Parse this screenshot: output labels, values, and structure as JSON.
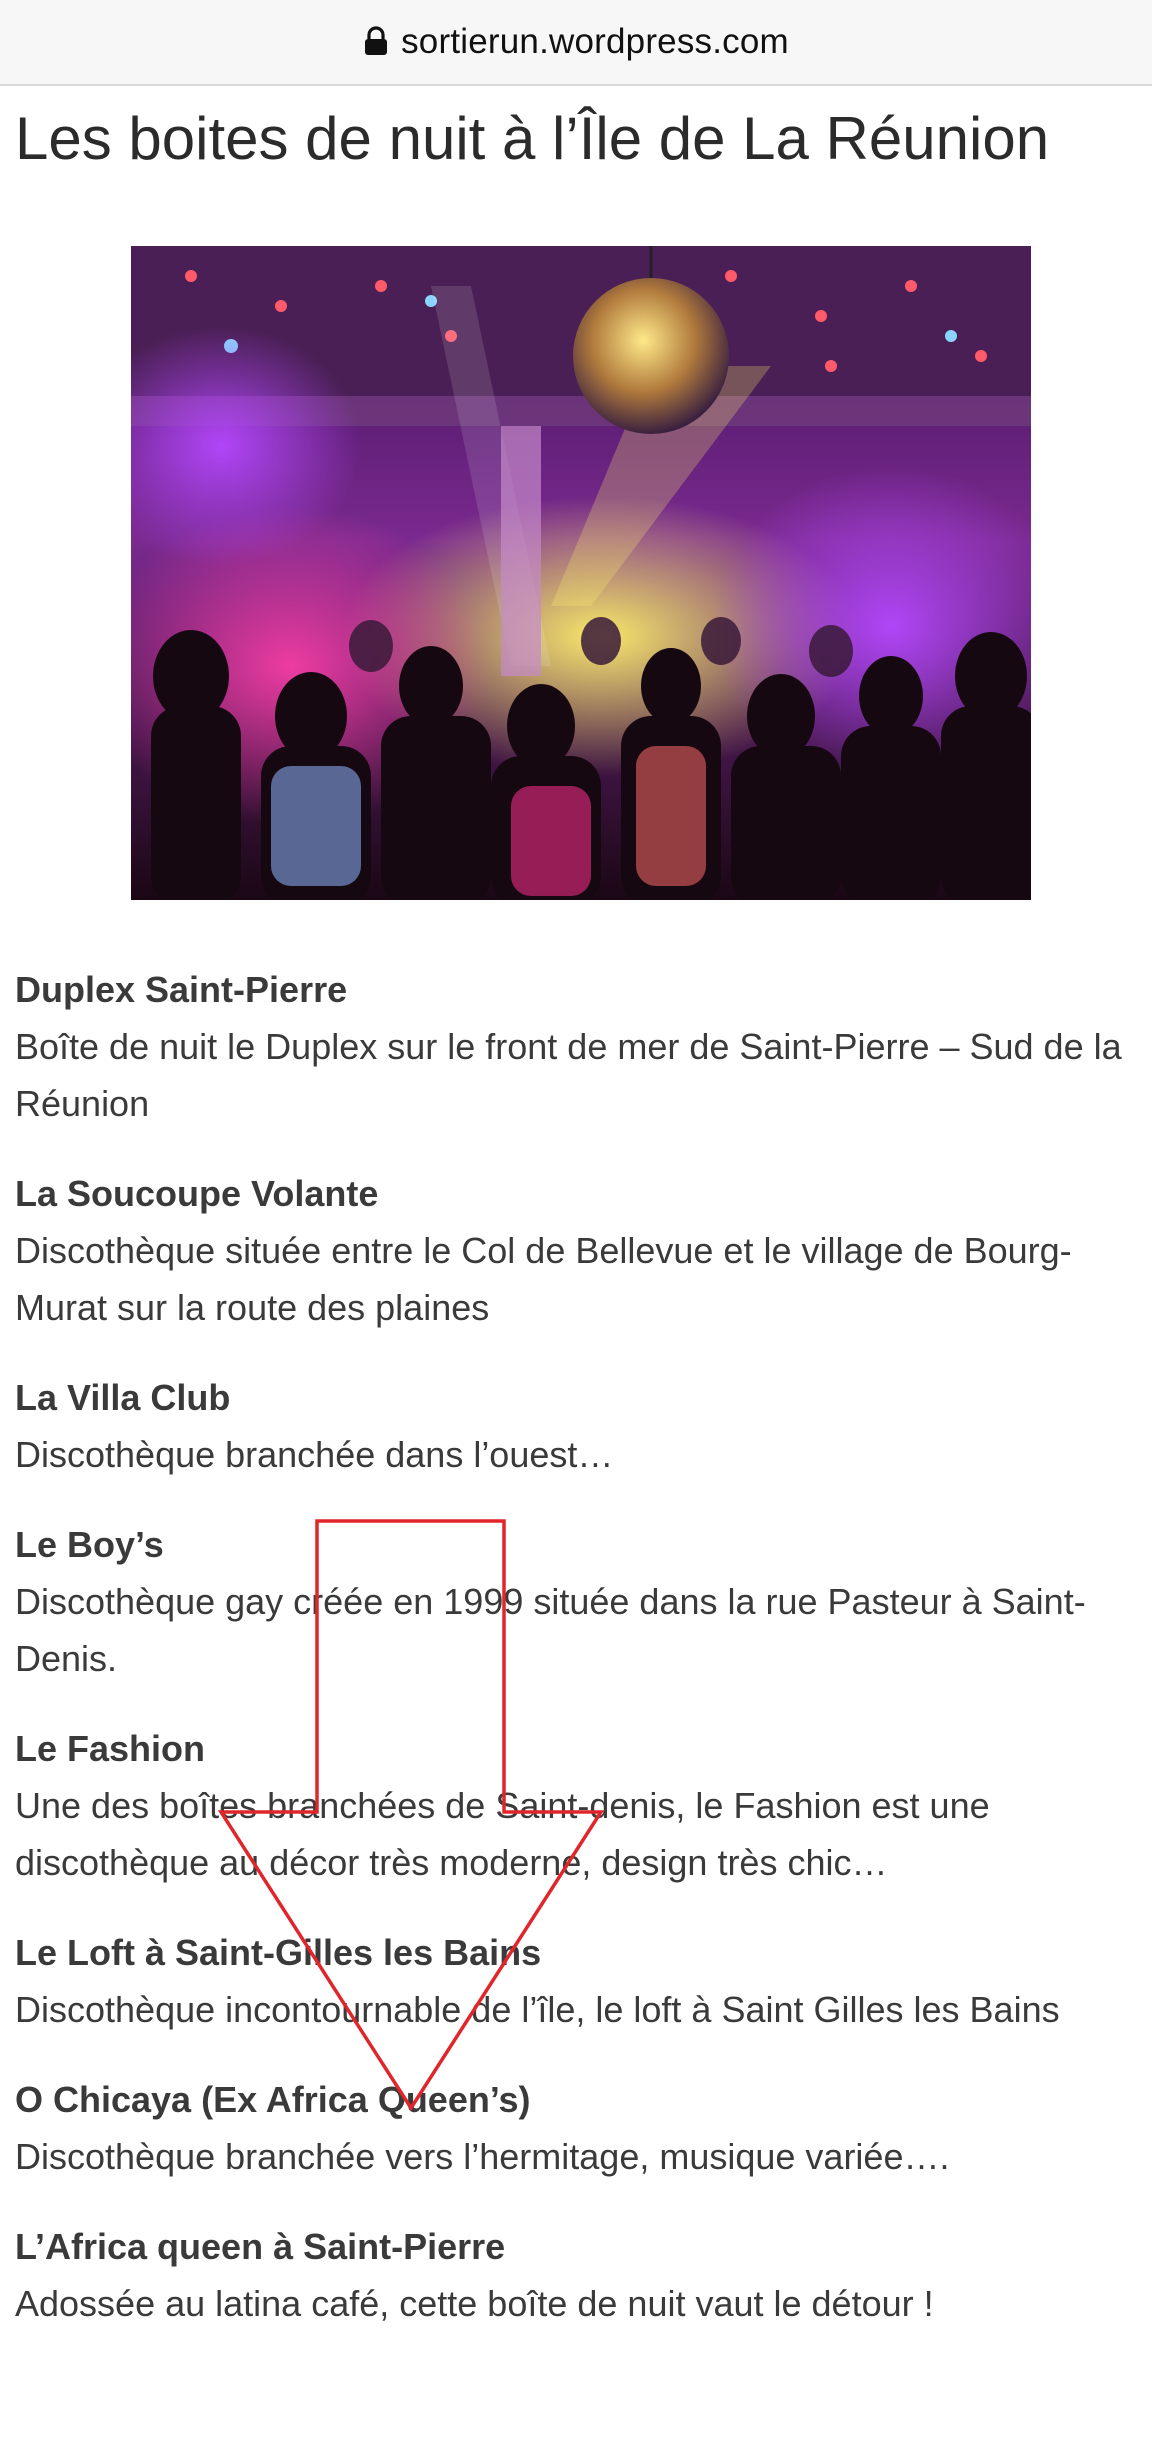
{
  "browser": {
    "url": "sortierun.wordpress.com",
    "lock_icon": "lock-icon"
  },
  "article": {
    "title": "Les boites de nuit à l’Île de La Réunion",
    "hero_image": "nightclub-dance-floor-photo",
    "entries": [
      {
        "title": "Duplex Saint-Pierre",
        "description": "Boîte de nuit le Duplex sur le front de mer de Saint-Pierre – Sud de la Réunion"
      },
      {
        "title": "La Soucoupe Volante",
        "description": "Discothèque située entre le Col de Bellevue et le village de Bourg-Murat sur la route des plaines"
      },
      {
        "title": "La Villa Club",
        "description": "Discothèque branchée dans l’ouest…"
      },
      {
        "title": "Le Boy’s",
        "description": "Discothèque gay créée en 1999 située dans la rue Pasteur à Saint-Denis."
      },
      {
        "title": "Le Fashion",
        "description": "Une des boîtes branchées de Saint-denis, le Fashion est une discothèque au décor très moderne, design très chic…"
      },
      {
        "title": "Le Loft à Saint-Gilles les Bains",
        "description": "Discothèque incontournable de l’île, le loft à Saint Gilles les Bains"
      },
      {
        "title": "O Chicaya (Ex Africa Queen’s)",
        "description": "Discothèque branchée vers l’hermitage, musique variée…."
      },
      {
        "title": "L’Africa queen à Saint-Pierre",
        "description": "Adossée au latina café, cette boîte de nuit vaut le détour !"
      }
    ]
  },
  "overlay": {
    "arrow_direction": "down",
    "arrow_color": "#e0262b"
  }
}
